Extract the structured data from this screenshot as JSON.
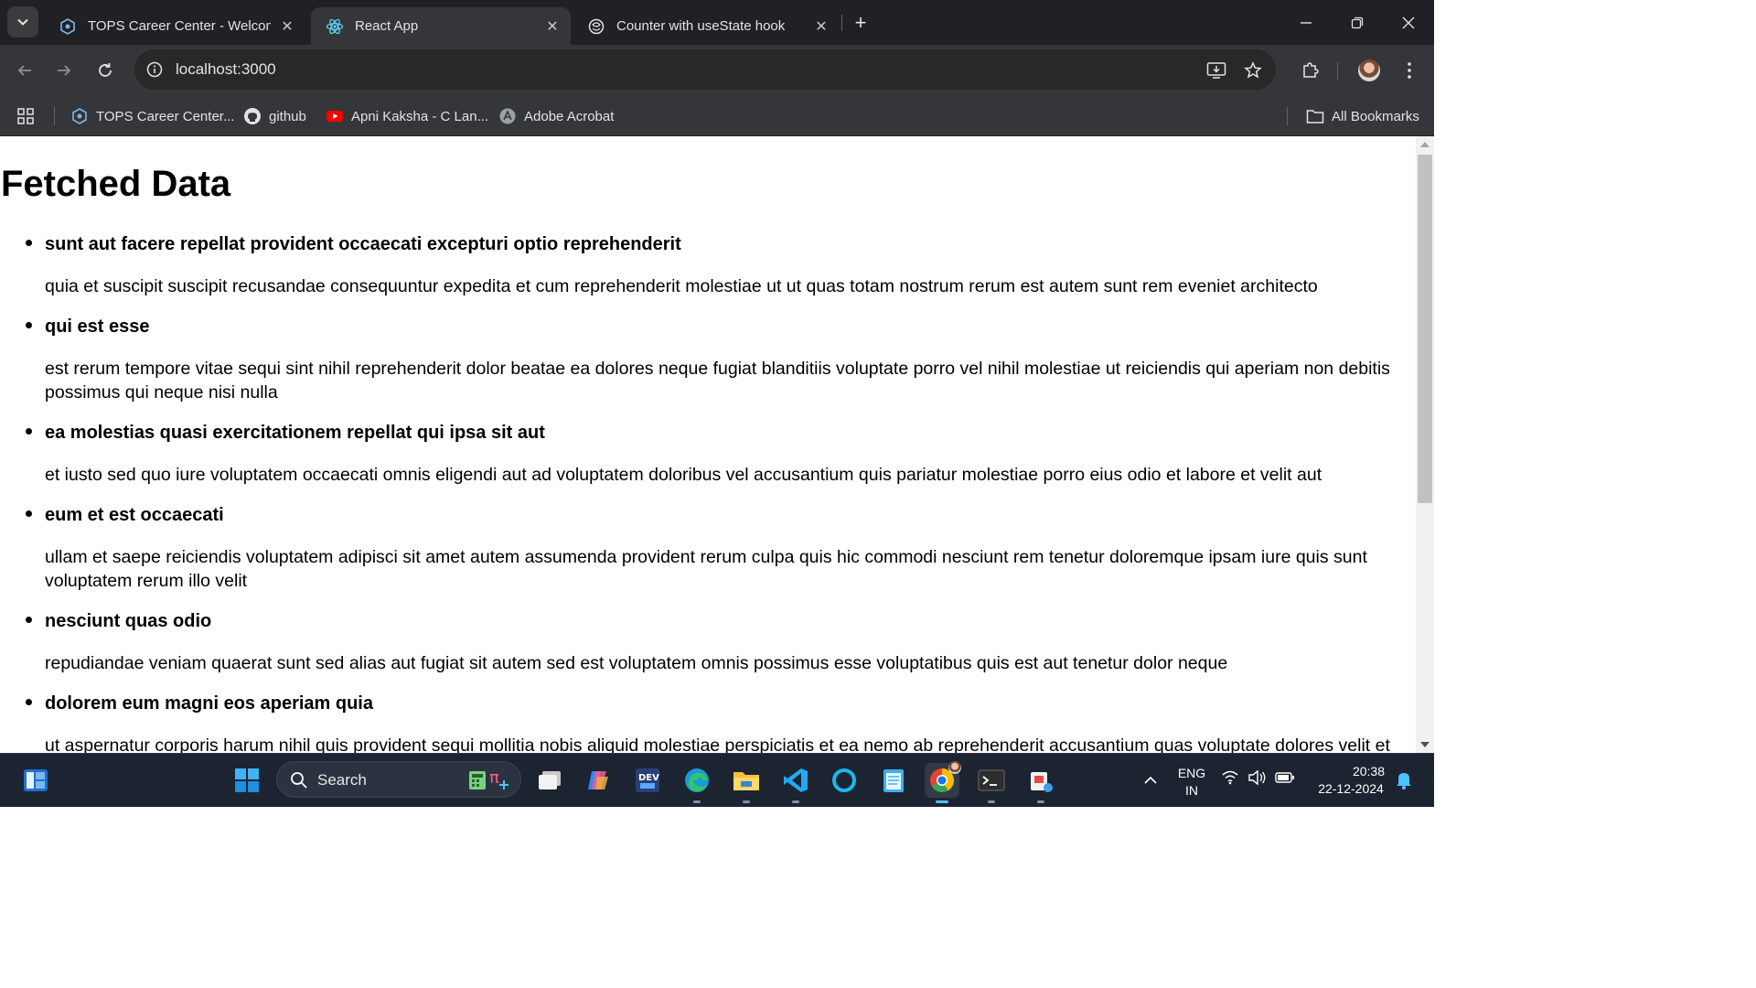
{
  "browser": {
    "tabs": [
      {
        "title": "TOPS Career Center - Welcome",
        "favicon": "tops-career-icon",
        "active": false
      },
      {
        "title": "React App",
        "favicon": "react-icon",
        "active": true
      },
      {
        "title": "Counter with useState hook",
        "favicon": "chatgpt-icon",
        "active": false
      }
    ],
    "close_glyph": "✕",
    "new_tab_glyph": "+",
    "url": "localhost:3000",
    "bookmarks": [
      {
        "label": "TOPS Career Center...",
        "icon": "tops-career-icon"
      },
      {
        "label": "github",
        "icon": "github-icon"
      },
      {
        "label": "Apni Kaksha - C Lan...",
        "icon": "youtube-icon"
      },
      {
        "label": "Adobe Acrobat",
        "icon": "adobe-acrobat-icon"
      }
    ],
    "all_bookmarks_label": "All Bookmarks"
  },
  "page": {
    "title": "Fetched Data",
    "posts": [
      {
        "title": "sunt aut facere repellat provident occaecati excepturi optio reprehenderit",
        "body": "quia et suscipit suscipit recusandae consequuntur expedita et cum reprehenderit molestiae ut ut quas totam nostrum rerum est autem sunt rem eveniet architecto"
      },
      {
        "title": "qui est esse",
        "body": "est rerum tempore vitae sequi sint nihil reprehenderit dolor beatae ea dolores neque fugiat blanditiis voluptate porro vel nihil molestiae ut reiciendis qui aperiam non debitis possimus qui neque nisi nulla"
      },
      {
        "title": "ea molestias quasi exercitationem repellat qui ipsa sit aut",
        "body": "et iusto sed quo iure voluptatem occaecati omnis eligendi aut ad voluptatem doloribus vel accusantium quis pariatur molestiae porro eius odio et labore et velit aut"
      },
      {
        "title": "eum et est occaecati",
        "body": "ullam et saepe reiciendis voluptatem adipisci sit amet autem assumenda provident rerum culpa quis hic commodi nesciunt rem tenetur doloremque ipsam iure quis sunt voluptatem rerum illo velit"
      },
      {
        "title": "nesciunt quas odio",
        "body": "repudiandae veniam quaerat sunt sed alias aut fugiat sit autem sed est voluptatem omnis possimus esse voluptatibus quis est aut tenetur dolor neque"
      },
      {
        "title": "dolorem eum magni eos aperiam quia",
        "body": "ut aspernatur corporis harum nihil quis provident sequi mollitia nobis aliquid molestiae perspiciatis et ea nemo ab reprehenderit accusantium quas voluptate dolores velit et doloremque molestiae"
      }
    ]
  },
  "taskbar": {
    "search_label": "Search",
    "lang_top": "ENG",
    "lang_bottom": "IN",
    "time": "20:38",
    "date": "22-12-2024",
    "apps": [
      "calculator-icon",
      "task-view-icon",
      "copilot-icon",
      "dev-home-icon",
      "edge-icon",
      "file-explorer-icon",
      "vscode-icon",
      "cortana-icon",
      "notepad-icon",
      "chrome-icon",
      "terminal-icon",
      "snipping-tool-icon"
    ]
  },
  "colors": {
    "tabstrip": "#202124",
    "toolbar": "#35363a",
    "taskbar": "#1c2431",
    "accent": "#4cc2ff"
  }
}
